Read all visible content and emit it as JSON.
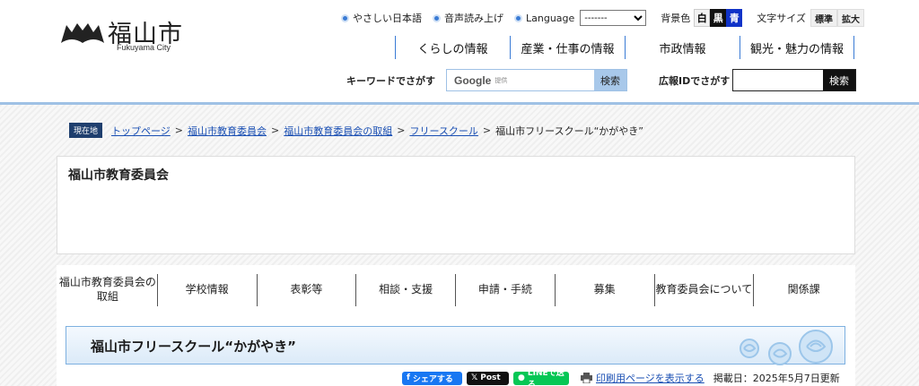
{
  "logo": {
    "name_jp": "福山市",
    "name_en": "Fukuyama City"
  },
  "util": {
    "easy_japanese": "やさしい日本語",
    "read_aloud": "音声読み上げ",
    "language": "Language",
    "language_selected": "-------",
    "bg_label": "背景色",
    "bg_white": "白",
    "bg_black": "黒",
    "bg_blue": "青",
    "font_label": "文字サイズ",
    "font_standard": "標準",
    "font_large": "拡大"
  },
  "global_nav": [
    "くらしの情報",
    "産業・仕事の情報",
    "市政情報",
    "観光・魅力の情報"
  ],
  "search": {
    "keyword_label": "キーワードでさがす",
    "google_brand": "Google",
    "google_provided": "提供",
    "button": "検索",
    "ad_label": "広報IDでさがす",
    "ad_button": "検索"
  },
  "breadcrumb": {
    "now_label": "現在地",
    "links": [
      "トップページ",
      "福山市教育委員会",
      "福山市教育委員会の取組",
      "フリースクール"
    ],
    "separator": ">",
    "current": "福山市フリースクール“かがやき”"
  },
  "board_title": "福山市教育委員会",
  "sub_nav": [
    "福山市教育委員会の取組",
    "学校情報",
    "表彰等",
    "相談・支援",
    "申請・手続",
    "募集",
    "教育委員会について",
    "関係課"
  ],
  "page_title": "福山市フリースクール“かがやき”",
  "share": {
    "facebook": "シェアする",
    "x": "Post",
    "line": "LINEで送る",
    "print": "印刷用ページを表示する",
    "posted": "掲載日：2025年5月7日更新"
  },
  "colors": {
    "accent": "#3a7bd5",
    "heading_border": "#7db0e0",
    "dark_nav": "#1f3f6e"
  }
}
